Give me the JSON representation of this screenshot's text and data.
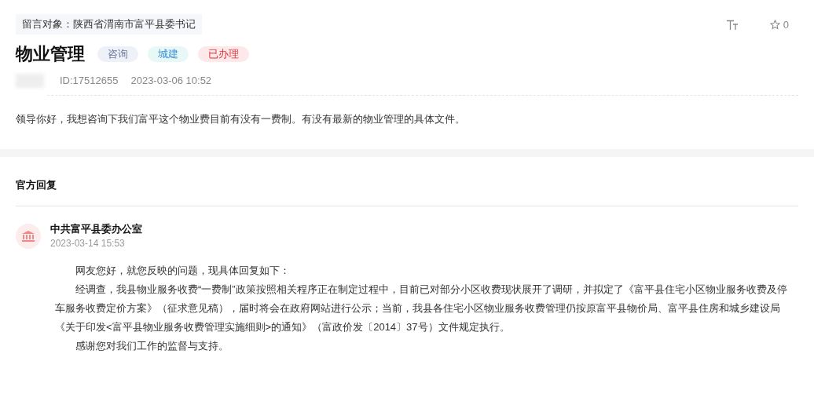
{
  "target": "留言对象：陕西省渭南市富平县委书记",
  "title": "物业管理",
  "tags": [
    {
      "label": "咨询",
      "kind": "type"
    },
    {
      "label": "城建",
      "kind": "category"
    },
    {
      "label": "已办理",
      "kind": "status"
    }
  ],
  "favorites": "0",
  "meta": {
    "id": "ID:17512655",
    "time": "2023-03-06 10:52"
  },
  "question": "领导你好，我想咨询下我们富平这个物业费目前有没有一费制。有没有最新的物业管理的具体文件。",
  "reply": {
    "heading": "官方回复",
    "author": "中共富平县委办公室",
    "time": "2023-03-14 15:53",
    "paragraphs": [
      "网友您好，就您反映的问题，现具体回复如下：",
      "经调查，我县物业服务收费“一费制”政策按照相关程序正在制定过程中，目前已对部分小区收费现状展开了调研，并拟定了《富平县住宅小区物业服务收费及停车服务收费定价方案》（征求意见稿），届时将会在政府网站进行公示；当前，我县各住宅小区物业服务收费管理仍按原富平县物价局、富平县住房和城乡建设局《关于印发<富平县物业服务收费管理实施细则>的通知》（富政价发〔2014〕37号）文件规定执行。",
      "感谢您对我们工作的监督与支持。"
    ]
  }
}
